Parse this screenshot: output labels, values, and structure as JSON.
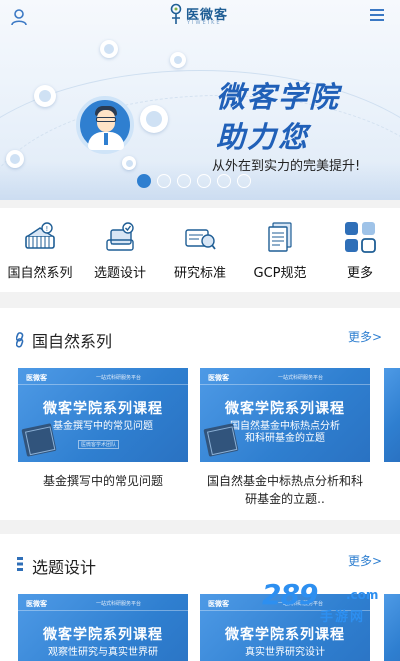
{
  "header": {
    "logo_text": "医微客",
    "logo_sub": "YIWEIKE"
  },
  "banner": {
    "title_line1": "微客学院",
    "title_line2": "助力您",
    "subtitle": "从外在到实力的完美提升!",
    "slides_total": 6,
    "active_slide": 1
  },
  "quick_nav": [
    {
      "label": "国自然系列",
      "icon": "books-icon"
    },
    {
      "label": "选题设计",
      "icon": "topic-design-icon"
    },
    {
      "label": "研究标准",
      "icon": "research-standard-icon"
    },
    {
      "label": "GCP规范",
      "icon": "document-stack-icon"
    },
    {
      "label": "更多",
      "icon": "grid-more-icon"
    }
  ],
  "sections": [
    {
      "title": "国自然系列",
      "more": "更多>",
      "cards": [
        {
          "thumb_logo": "医微客",
          "thumb_slogan": "一站式科研服务平台",
          "thumb_title": "微客学院系列课程",
          "thumb_sub": "基金撰写中的常见问题",
          "thumb_chip": "医微客学术团队",
          "caption": "基金撰写中的常见问题"
        },
        {
          "thumb_logo": "医微客",
          "thumb_slogan": "一站式科研服务平台",
          "thumb_title": "微客学院系列课程",
          "thumb_sub": "国自然基金中标热点分析",
          "thumb_sub2": "和科研基金的立题",
          "caption": "国自然基金中标热点分析和科研基金的立题.."
        }
      ]
    },
    {
      "title": "选题设计",
      "more": "更多>",
      "cards": [
        {
          "thumb_logo": "医微客",
          "thumb_slogan": "一站式科研服务平台",
          "thumb_title": "微客学院系列课程",
          "thumb_sub": "观察性研究与真实世界研"
        },
        {
          "thumb_logo": "医微客",
          "thumb_slogan": "一站式科研服务平台",
          "thumb_title": "微客学院系列课程",
          "thumb_sub": "真实世界研究设计"
        }
      ]
    }
  ],
  "watermark": {
    "number": "289",
    "domain": ".com",
    "name": "手游网"
  },
  "colors": {
    "brand_blue": "#2f7fd0",
    "title_blue": "#2060b8",
    "link_blue": "#2f7fd0"
  }
}
